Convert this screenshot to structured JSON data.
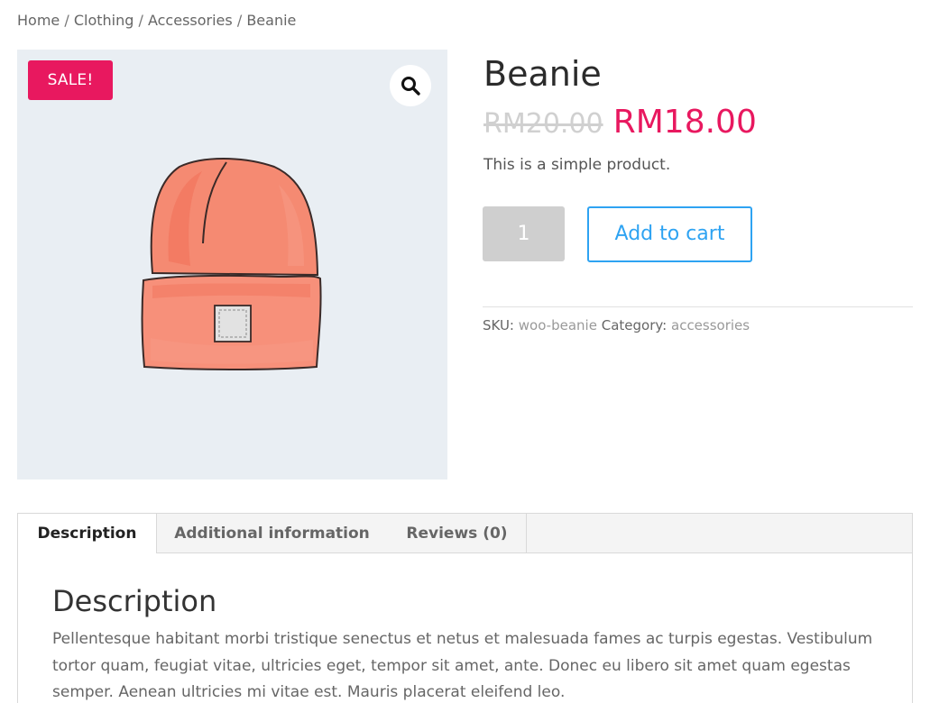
{
  "breadcrumb": {
    "items": [
      "Home",
      "Clothing",
      "Accessories",
      "Beanie"
    ],
    "separator": "/"
  },
  "gallery": {
    "sale_badge": "SALE!",
    "zoom_icon": "magnifier-icon",
    "image_subject": "orange-beanie-illustration",
    "background_color": "#e9eef3"
  },
  "product": {
    "title": "Beanie",
    "price_old": "RM20.00",
    "price_new": "RM18.00",
    "short_description": "This is a simple product.",
    "quantity": "1",
    "add_to_cart_label": "Add to cart",
    "sku_label": "SKU:",
    "sku_value": "woo-beanie",
    "category_label": "Category:",
    "category_value": "accessories"
  },
  "tabs": {
    "items": [
      {
        "label": "Description",
        "active": true
      },
      {
        "label": "Additional information",
        "active": false
      },
      {
        "label": "Reviews (0)",
        "active": false
      }
    ]
  },
  "description_panel": {
    "heading": "Description",
    "text": "Pellentesque habitant morbi tristique senectus et netus et malesuada fames ac turpis egestas. Vestibulum tortor quam, feugiat vitae, ultricies eget, tempor sit amet, ante. Donec eu libero sit amet quam egestas semper. Aenean ultricies mi vitae est. Mauris placerat eleifend leo."
  },
  "colors": {
    "sale": "#e8185f",
    "accent": "#2ea3f2",
    "old_price": "#d0d0d0"
  }
}
